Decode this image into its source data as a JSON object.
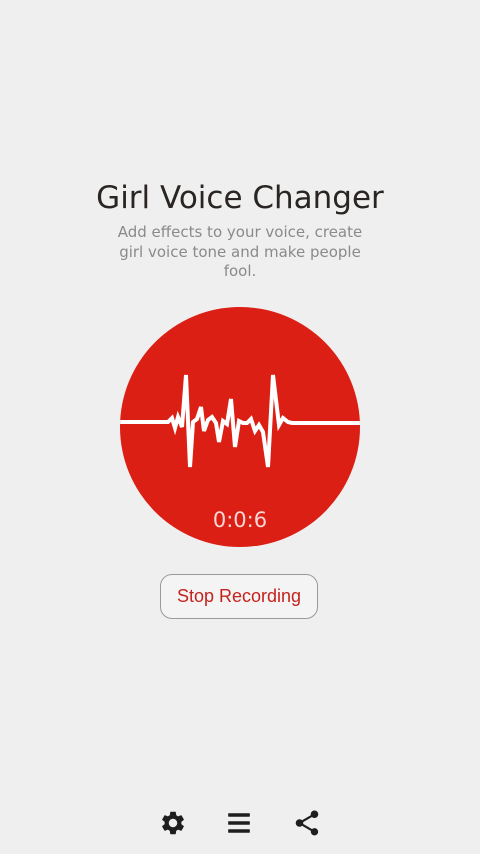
{
  "header": {
    "title": "Girl Voice Changer",
    "subtitle": "Add effects to your voice, create girl voice tone and make people fool."
  },
  "recorder": {
    "timer": "0:0:6",
    "circle_color": "#dc1f15",
    "waveform_icon": "heartbeat-waveform"
  },
  "controls": {
    "stop_label": "Stop Recording"
  },
  "bottom_bar": {
    "icons": [
      "gear-icon",
      "menu-icon",
      "share-icon"
    ]
  },
  "colors": {
    "background": "#efefef",
    "accent": "#dc1f15",
    "button_text": "#c4221c"
  }
}
